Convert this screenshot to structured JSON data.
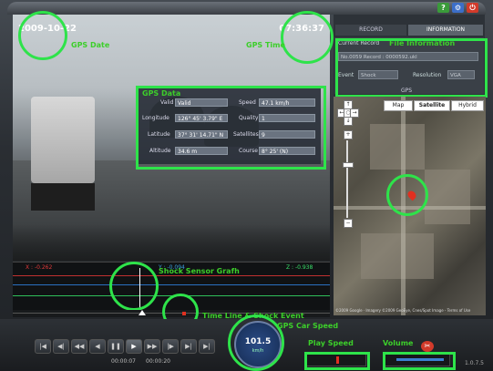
{
  "overlay": {
    "date": "2009-10-22",
    "time": "07:36:37",
    "gps_date_label": "GPS Date",
    "gps_time_label": "GPS Time"
  },
  "gps": {
    "title": "GPS Data",
    "valid_label": "Valid",
    "valid_value": "Valid",
    "speed_label": "Speed",
    "speed_value": "47.1 km/h",
    "longitude_label": "Longitude",
    "longitude_value": "126° 45' 3.79\" E",
    "quality_label": "Quality",
    "quality_value": "1",
    "latitude_label": "Latitude",
    "latitude_value": "37° 31' 14.71\" N",
    "satellites_label": "Satellites",
    "satellites_value": "9",
    "altitude_label": "Altitude",
    "altitude_value": "34.6 m",
    "course_label": "Course",
    "course_value": "8° 25' (N)"
  },
  "tabs": {
    "record": "RECORD",
    "information": "INFORMATION"
  },
  "file_info": {
    "title": "File Information",
    "current_record_label": "Current Record",
    "current_record_value": "No.0059 Record : 0000592.ukl",
    "event_label": "Event",
    "event_value": "Shock",
    "resolution_label": "Resolution",
    "resolution_value": "VGA",
    "gps_label": "GPS"
  },
  "map": {
    "map_btn": "Map",
    "satellite_btn": "Satellite",
    "hybrid_btn": "Hybrid",
    "copyright": "©2009 Google · Imagery ©2009 GeoEye, Cnes/Spot Image - Terms of Use"
  },
  "graph": {
    "x_label": "X : -0.262",
    "y_label": "Y : -0.094",
    "z_label": "Z : -0.938",
    "callout": "Shock Sensor Grafh"
  },
  "timeline": {
    "callout": "Time Line & Shock Event"
  },
  "controls": {
    "speed_callout": "GPS Car Speed",
    "speed_value": "101.5",
    "speed_unit": "km/h",
    "play_speed_label": "Play Speed",
    "volume_label": "Volume",
    "time_current": "00:00:07",
    "time_total": "00:00:20",
    "version": "1.0.7.5"
  }
}
